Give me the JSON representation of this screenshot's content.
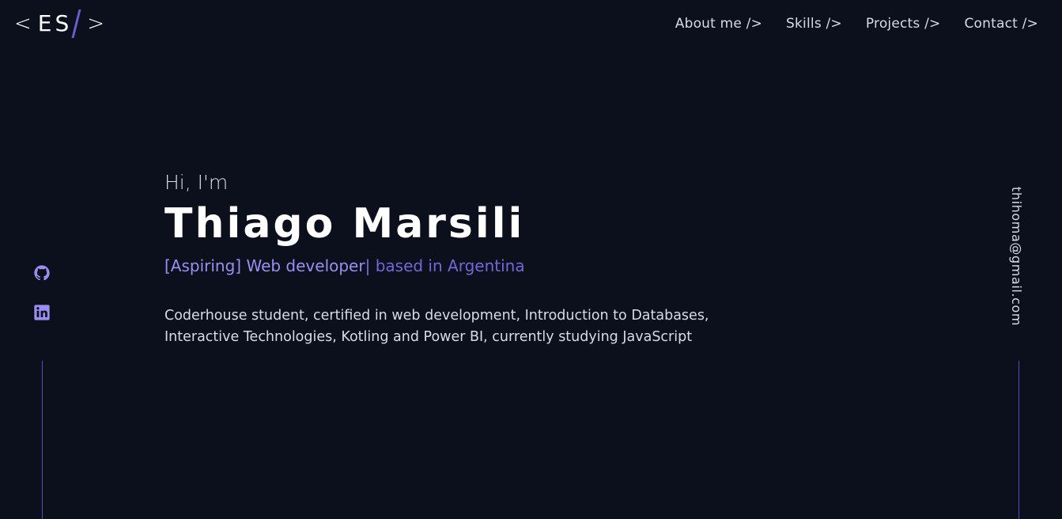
{
  "logo": {
    "open_bracket": "<",
    "letters": "ES",
    "close_bracket": ">"
  },
  "nav": {
    "items": [
      {
        "label": "About me />"
      },
      {
        "label": "Skills />"
      },
      {
        "label": "Projects />"
      },
      {
        "label": "Contact />"
      }
    ]
  },
  "social": {
    "icons": [
      "github-icon",
      "linkedin-icon"
    ],
    "accent": "#9c8ef0"
  },
  "email": "thihoma@gmail.com",
  "hero": {
    "greeting": "Hi, I'm",
    "name": "Thiago Marsili",
    "tagline_typed": "[Aspiring] Web developer",
    "tagline_cursor": "|",
    "tagline_location": " based in Argentina",
    "description_line1": "Coderhouse student, certified in web development, Introduction to Databases,",
    "description_line2": "Interactive Technologies, Kotling and Power BI, currently studying JavaScript"
  },
  "colors": {
    "background": "#0c101d",
    "accent": "#6d5bd0",
    "text": "#d8dbe6"
  }
}
